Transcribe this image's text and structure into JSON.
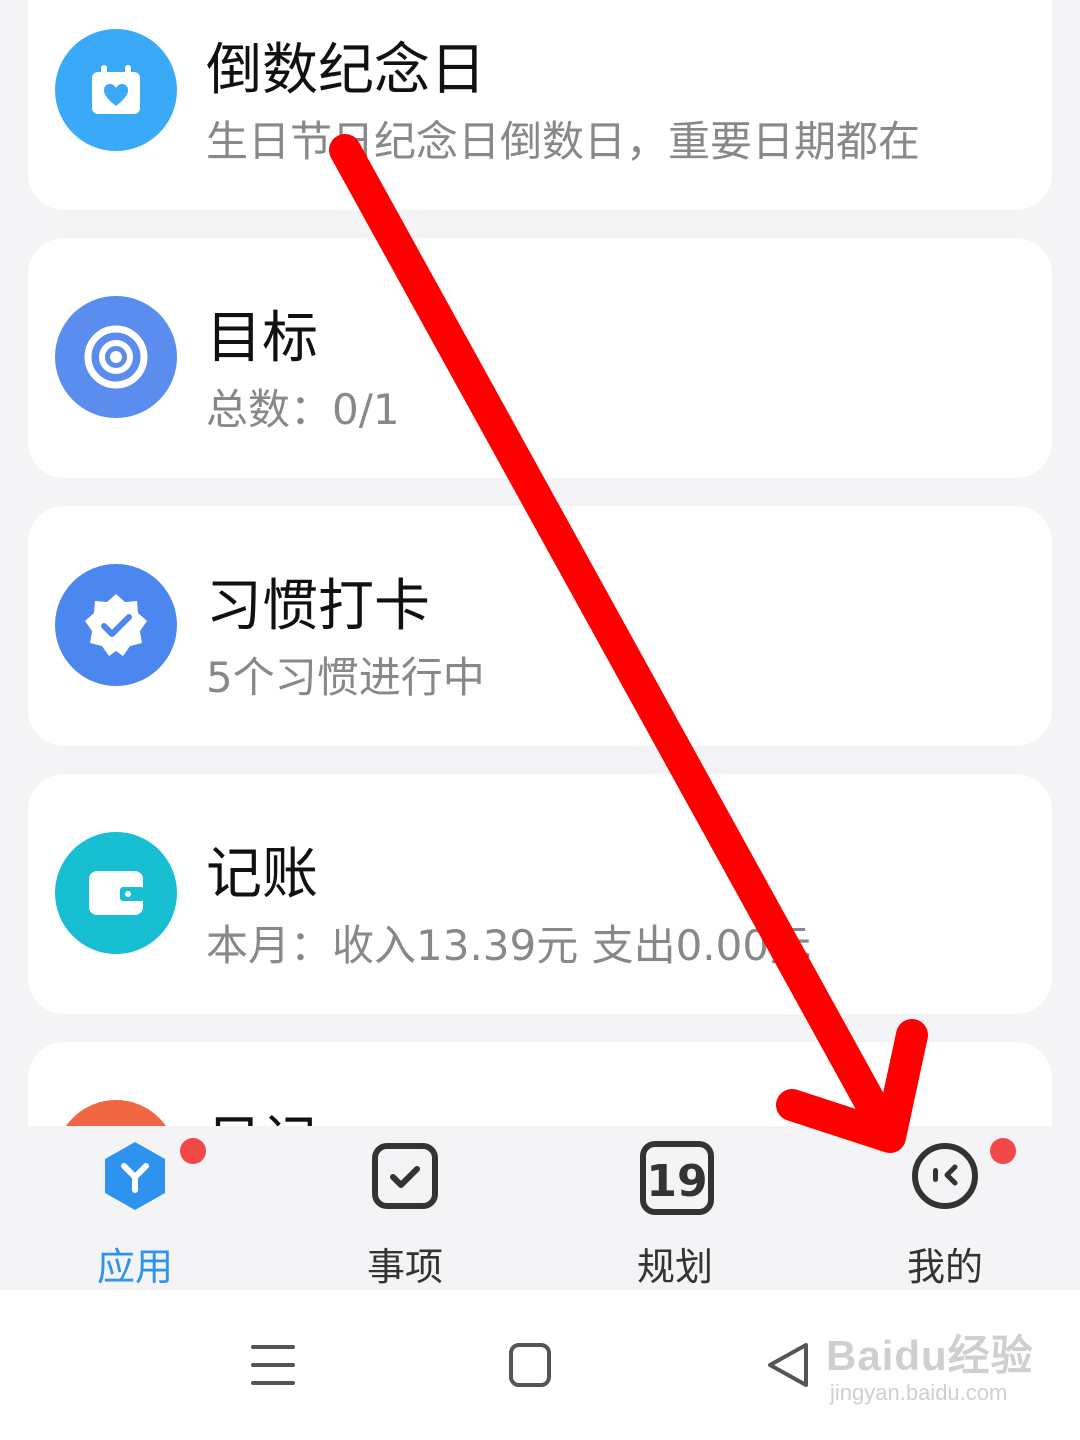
{
  "cards": [
    {
      "title": "倒数纪念日",
      "subtitle": "生日节日纪念日倒数日，重要日期都在",
      "icon": "calendar-heart-icon",
      "color": "#3aa9f7"
    },
    {
      "title": "目标",
      "subtitle": "总数：0/1",
      "icon": "target-icon",
      "color": "#5b8def"
    },
    {
      "title": "习惯打卡",
      "subtitle": "5个习惯进行中",
      "icon": "badge-check-icon",
      "color": "#4c87ef"
    },
    {
      "title": "记账",
      "subtitle": "本月：收入13.39元 支出0.00元",
      "icon": "wallet-icon",
      "color": "#18bed2"
    },
    {
      "title": "日记",
      "icon": "diary-icon",
      "color": "#f26743"
    }
  ],
  "tabbar": {
    "tabs": [
      {
        "label": "应用",
        "icon": "apps-icon",
        "active": true,
        "badge": true
      },
      {
        "label": "事项",
        "icon": "checkbox-icon",
        "active": false,
        "badge": false
      },
      {
        "label": "规划",
        "icon": "calendar-date-icon",
        "date_number": "19",
        "active": false,
        "badge": false
      },
      {
        "label": "我的",
        "icon": "profile-face-icon",
        "active": false,
        "badge": true
      }
    ],
    "active_color": "#2e93ee"
  },
  "watermark": {
    "main": "Baidu经验",
    "sub": "jingyan.baidu.com"
  },
  "annotation": {
    "arrow_color": "#ff0000"
  }
}
